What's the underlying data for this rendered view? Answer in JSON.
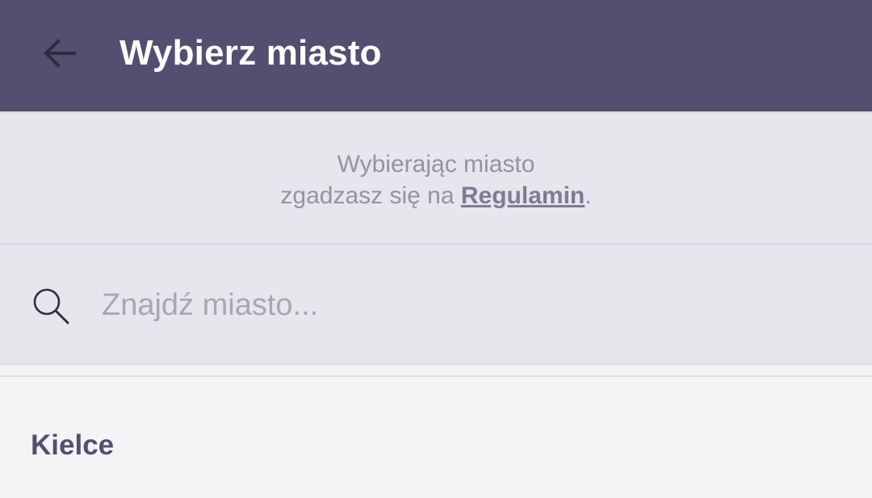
{
  "toolbar": {
    "title": "Wybierz miasto",
    "back_icon": "arrow-left-icon",
    "background": "#534f70"
  },
  "terms": {
    "line1": "Wybierając miasto",
    "line2_prefix": "zgadzasz się na ",
    "link_label": "Regulamin",
    "line2_suffix": "."
  },
  "search": {
    "icon": "search-icon",
    "placeholder": "Znajdź miasto...",
    "value": ""
  },
  "cities": [
    {
      "label": "Kielce"
    }
  ],
  "colors": {
    "accent": "#534f70",
    "panel": "#e7e6ed",
    "list_background": "#f4f4f7",
    "muted_text": "#9592a6"
  }
}
